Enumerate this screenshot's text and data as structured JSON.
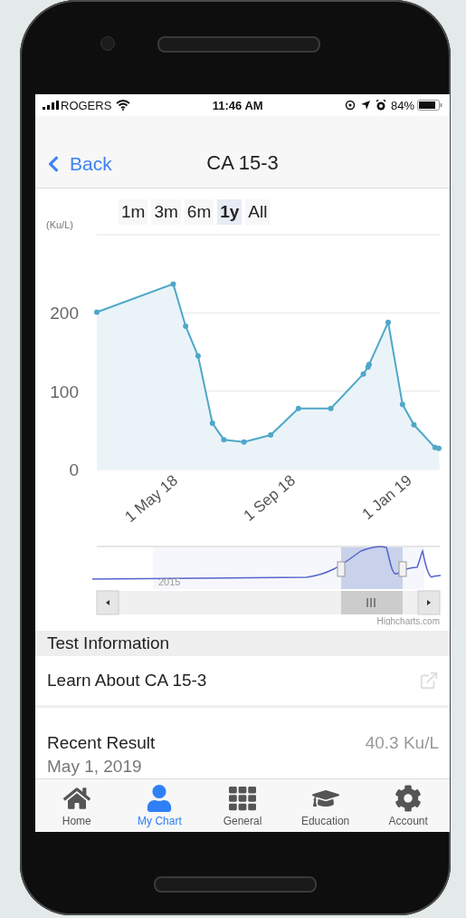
{
  "status_bar": {
    "carrier": "ROGERS",
    "time": "11:46 AM",
    "battery": "84%"
  },
  "nav": {
    "back": "Back",
    "title": "CA 15-3"
  },
  "chart": {
    "unit": "(Ku/L)",
    "ranges": [
      {
        "label": "1m",
        "selected": false
      },
      {
        "label": "3m",
        "selected": false
      },
      {
        "label": "6m",
        "selected": false
      },
      {
        "label": "1y",
        "selected": true
      },
      {
        "label": "All",
        "selected": false
      }
    ],
    "chart_data": {
      "type": "area",
      "xlim": [
        "2018-02-08",
        "2019-02-02"
      ],
      "ylim": [
        0,
        300
      ],
      "x": [
        "2018-02-08",
        "2018-04-29",
        "2018-05-12",
        "2018-05-25",
        "2018-06-09",
        "2018-06-21",
        "2018-07-12",
        "2018-08-09",
        "2018-09-07",
        "2018-10-11",
        "2018-11-14",
        "2018-11-19",
        "2018-11-20",
        "2018-12-10",
        "2018-12-25",
        "2019-01-06",
        "2019-01-28",
        "2019-02-01"
      ],
      "series": [
        {
          "color": "#4fa7c9",
          "values": [
            201,
            237,
            183,
            145,
            59,
            38,
            35,
            44,
            78,
            78,
            122,
            131,
            134,
            188,
            83,
            57,
            28,
            27
          ]
        }
      ],
      "yticks": [
        0,
        100,
        200
      ],
      "xticks": [
        {
          "value": "2018-05-01",
          "label": "1 May 18"
        },
        {
          "value": "2018-09-01",
          "label": "1 Sep 18"
        },
        {
          "value": "2019-01-01",
          "label": "1 Jan 19"
        }
      ]
    },
    "navigator_label": "2015",
    "credits": "Highcharts.com"
  },
  "section_header": "Test Information",
  "learn_link": "Learn About CA 15-3",
  "recent": {
    "label": "Recent Result",
    "value": "40.3 Ku/L",
    "date": "May 1, 2019"
  },
  "tabs": [
    {
      "label": "Home",
      "selected": false
    },
    {
      "label": "My Chart",
      "selected": true
    },
    {
      "label": "General",
      "selected": false
    },
    {
      "label": "Education",
      "selected": false
    },
    {
      "label": "Account",
      "selected": false
    }
  ]
}
